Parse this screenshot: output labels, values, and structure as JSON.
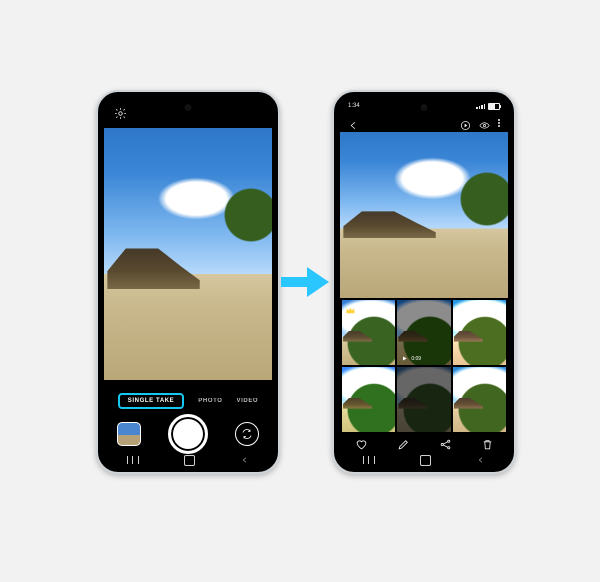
{
  "camera_app": {
    "modes": {
      "selected": "SINGLE TAKE",
      "right1": "PHOTO",
      "right2": "VIDEO"
    },
    "settings_icon": "gear-icon",
    "last_thumb": "last-shot-thumbnail",
    "shutter": "shutter-button",
    "switch": "switch-camera-button"
  },
  "gallery_app": {
    "status": {
      "time": "1:34",
      "signal": "lte"
    },
    "topbar": {
      "back": "back-icon",
      "play": "play-icon",
      "eye": "visibility-icon",
      "more": "more-icon"
    },
    "tiles": {
      "t0_best": "crown-icon",
      "t1_duration": "0:09"
    },
    "actions": {
      "fav": "heart-icon",
      "edit": "edit-icon",
      "share": "share-icon",
      "delete": "trash-icon"
    }
  },
  "navbar": {
    "recent": "recent-apps",
    "home": "home",
    "back": "back"
  }
}
